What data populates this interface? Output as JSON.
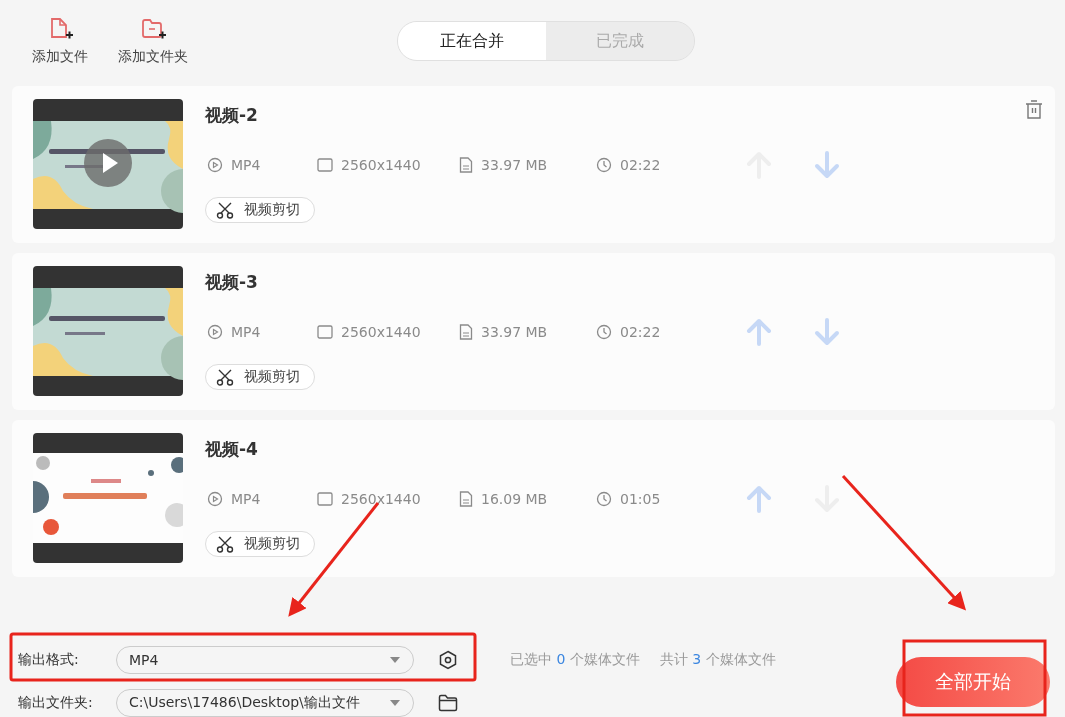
{
  "toolbar": [
    {
      "kind": "file",
      "label": "添加文件"
    },
    {
      "kind": "folder",
      "label": "添加文件夹"
    }
  ],
  "tabs": [
    {
      "label": "正在合并",
      "selected": true
    },
    {
      "label": "已完成",
      "selected": false
    }
  ],
  "videos": [
    {
      "title": "视频-2",
      "format": "MP4",
      "resolution": "2560x1440",
      "size": "33.97 MB",
      "duration": "02:22",
      "trim_label": "视频剪切",
      "hovered": true,
      "up_disabled": true,
      "down_disabled": false
    },
    {
      "title": "视频-3",
      "format": "MP4",
      "resolution": "2560x1440",
      "size": "33.97 MB",
      "duration": "02:22",
      "trim_label": "视频剪切",
      "hovered": false,
      "up_disabled": false,
      "down_disabled": false
    },
    {
      "title": "视频-4",
      "format": "MP4",
      "resolution": "2560x1440",
      "size": "16.09 MB",
      "duration": "01:05",
      "trim_label": "视频剪切",
      "hovered": false,
      "up_disabled": false,
      "down_disabled": true
    }
  ],
  "output": {
    "format_label": "输出格式:",
    "format_value": "MP4",
    "folder_label": "输出文件夹:",
    "folder_value": "C:\\Users\\17486\\Desktop\\输出文件"
  },
  "status": {
    "selected": "已选中 **0** 个媒体文件",
    "total": "共计 **3** 个媒体文件"
  },
  "start_button": "全部开始"
}
